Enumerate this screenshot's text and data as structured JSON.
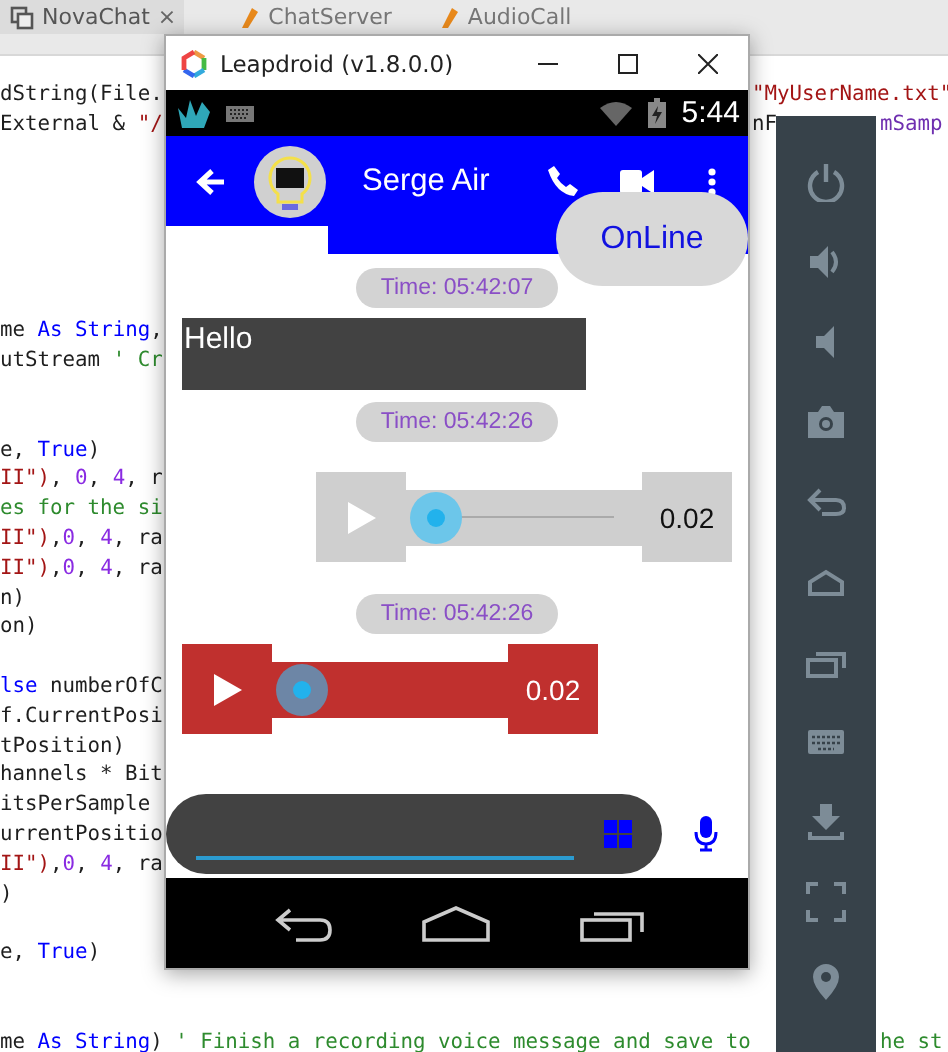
{
  "editor": {
    "tabs": [
      {
        "label": "NovaChat",
        "selected": true,
        "close": "×"
      },
      {
        "label": "ChatServer",
        "selected": false
      },
      {
        "label": "AudioCall",
        "selected": false
      }
    ],
    "lines": [
      {
        "left": [
          {
            "text": "dString(File.",
            "kind": "plain"
          }
        ],
        "right": [
          {
            "text": "\"MyUserName.txt\"",
            "kind": "string"
          }
        ]
      },
      {
        "left": [
          {
            "text": "External & ",
            "kind": "plain"
          },
          {
            "text": "\"/",
            "kind": "string"
          }
        ],
        "right": [
          {
            "text": "nF",
            "kind": "plain"
          }
        ],
        "far": [
          {
            "text": "mSamp",
            "kind": "field"
          }
        ]
      },
      {
        "left": [
          {
            "text": "me ",
            "kind": "plain"
          },
          {
            "text": "As",
            "kind": "keyword"
          },
          {
            "text": " String",
            "kind": "keyword"
          },
          {
            "text": ",",
            "kind": "plain"
          }
        ]
      },
      {
        "left": [
          {
            "text": "utStream ",
            "kind": "plain"
          },
          {
            "text": "' Cr",
            "kind": "comment"
          }
        ]
      },
      {
        "left": [
          {
            "text": "e, ",
            "kind": "plain"
          },
          {
            "text": "True",
            "kind": "keyword"
          },
          {
            "text": ")",
            "kind": "plain"
          }
        ]
      },
      {
        "left": [
          {
            "text": "II\")",
            "kind": "string"
          },
          {
            "text": ", ",
            "kind": "plain"
          },
          {
            "text": "0",
            "kind": "number"
          },
          {
            "text": ", ",
            "kind": "plain"
          },
          {
            "text": "4",
            "kind": "number"
          },
          {
            "text": ", r",
            "kind": "plain"
          }
        ]
      },
      {
        "left": [
          {
            "text": "es for the si",
            "kind": "comment"
          }
        ]
      },
      {
        "left": [
          {
            "text": "II\")",
            "kind": "string"
          },
          {
            "text": ",",
            "kind": "plain"
          },
          {
            "text": "0",
            "kind": "number"
          },
          {
            "text": ", ",
            "kind": "plain"
          },
          {
            "text": "4",
            "kind": "number"
          },
          {
            "text": ", ra",
            "kind": "plain"
          }
        ]
      },
      {
        "left": [
          {
            "text": "II\")",
            "kind": "string"
          },
          {
            "text": ",",
            "kind": "plain"
          },
          {
            "text": "0",
            "kind": "number"
          },
          {
            "text": ", ",
            "kind": "plain"
          },
          {
            "text": "4",
            "kind": "number"
          },
          {
            "text": ", ra",
            "kind": "plain"
          }
        ]
      },
      {
        "left": [
          {
            "text": "n)",
            "kind": "plain"
          }
        ]
      },
      {
        "left": [
          {
            "text": "on)",
            "kind": "plain"
          }
        ]
      },
      {
        "left": [
          {
            "text": "lse",
            "kind": "keyword"
          },
          {
            "text": " numberOfC",
            "kind": "plain"
          }
        ]
      },
      {
        "left": [
          {
            "text": "f.CurrentPosi",
            "kind": "plain"
          }
        ]
      },
      {
        "left": [
          {
            "text": "tPosition)",
            "kind": "plain"
          }
        ]
      },
      {
        "left": [
          {
            "text": "hannels * Bit",
            "kind": "plain"
          }
        ]
      },
      {
        "left": [
          {
            "text": "itsPerSample",
            "kind": "plain"
          }
        ]
      },
      {
        "left": [
          {
            "text": "urrentPositio",
            "kind": "plain"
          }
        ]
      },
      {
        "left": [
          {
            "text": "II\")",
            "kind": "string"
          },
          {
            "text": ",",
            "kind": "plain"
          },
          {
            "text": "0",
            "kind": "number"
          },
          {
            "text": ", ",
            "kind": "plain"
          },
          {
            "text": "4",
            "kind": "number"
          },
          {
            "text": ", ra",
            "kind": "plain"
          }
        ]
      },
      {
        "left": [
          {
            "text": ")",
            "kind": "plain"
          }
        ]
      },
      {
        "left": [
          {
            "text": "e, ",
            "kind": "plain"
          },
          {
            "text": "True",
            "kind": "keyword"
          },
          {
            "text": ")",
            "kind": "plain"
          }
        ]
      },
      {
        "left": [
          {
            "text": "me ",
            "kind": "plain"
          },
          {
            "text": "As",
            "kind": "keyword"
          },
          {
            "text": " String",
            "kind": "keyword"
          },
          {
            "text": ") ",
            "kind": "plain"
          },
          {
            "text": "' Finish a recording voice message and save to",
            "kind": "comment"
          }
        ],
        "far": [
          {
            "text": "he st",
            "kind": "comment"
          }
        ]
      }
    ]
  },
  "emulator": {
    "title": "Leapdroid (v1.8.0.0)",
    "status_bar": {
      "time": "5:44"
    },
    "app_bar": {
      "contact": "Serge Air"
    },
    "presence": "OnLine",
    "messages": [
      {
        "kind": "time",
        "text": "Time: 05:42:07"
      },
      {
        "kind": "text",
        "text": "Hello"
      },
      {
        "kind": "time",
        "text": "Time: 05:42:26"
      },
      {
        "kind": "audio_sent",
        "duration": "0.02",
        "level": 0
      },
      {
        "kind": "time",
        "text": "Time: 05:42:26"
      },
      {
        "kind": "audio_received",
        "duration": "0.02",
        "level": 0
      }
    ]
  }
}
